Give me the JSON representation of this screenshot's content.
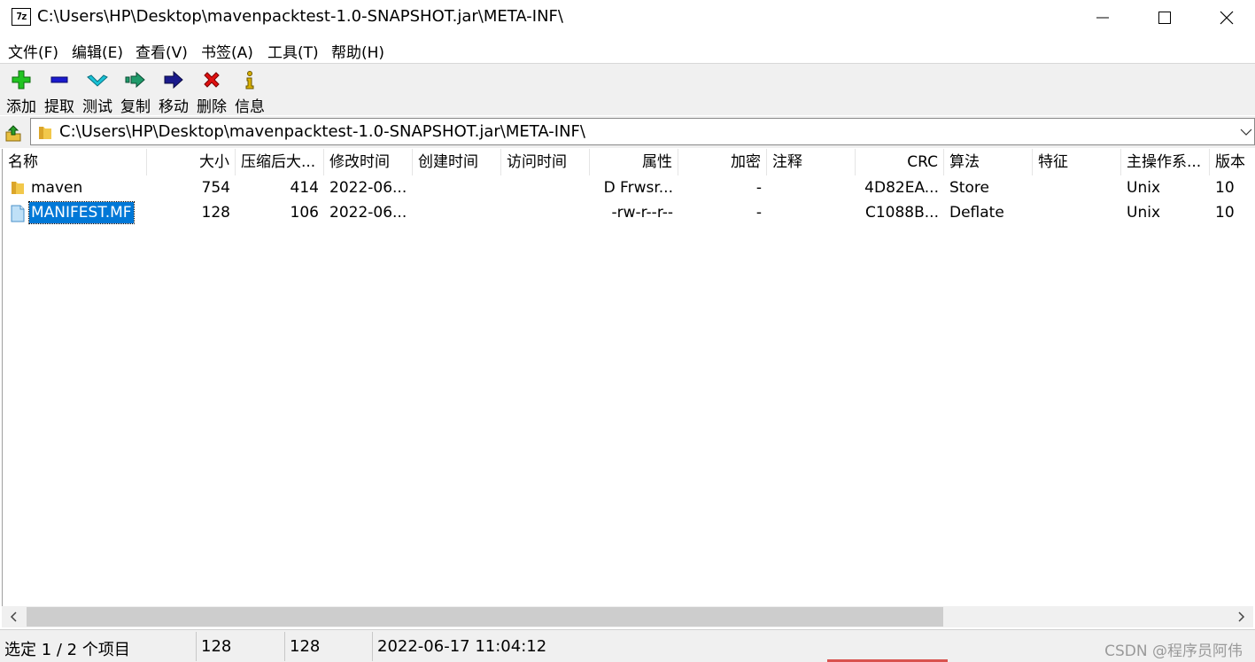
{
  "window": {
    "icon_text": "7z",
    "title": "C:\\Users\\HP\\Desktop\\mavenpacktest-1.0-SNAPSHOT.jar\\META-INF\\"
  },
  "menu": [
    {
      "label": "文件(F)"
    },
    {
      "label": "编辑(E)"
    },
    {
      "label": "查看(V)"
    },
    {
      "label": "书签(A)"
    },
    {
      "label": "工具(T)"
    },
    {
      "label": "帮助(H)"
    }
  ],
  "toolbar": [
    {
      "label": "添加",
      "icon": "plus-icon",
      "color": "#22b422"
    },
    {
      "label": "提取",
      "icon": "minus-icon",
      "color": "#1a1acd"
    },
    {
      "label": "测试",
      "icon": "check-icon",
      "color": "#19b6c8"
    },
    {
      "label": "复制",
      "icon": "double-arrow-icon",
      "color": "#1f9a6a"
    },
    {
      "label": "移动",
      "icon": "arrow-right-icon",
      "color": "#1a1a8c"
    },
    {
      "label": "删除",
      "icon": "x-icon",
      "color": "#e01010"
    },
    {
      "label": "信息",
      "icon": "info-icon",
      "color": "#c8a000"
    }
  ],
  "address": {
    "path": "C:\\Users\\HP\\Desktop\\mavenpacktest-1.0-SNAPSHOT.jar\\META-INF\\"
  },
  "columns": [
    {
      "label": "名称"
    },
    {
      "label": "大小"
    },
    {
      "label": "压缩后大..."
    },
    {
      "label": "修改时间"
    },
    {
      "label": "创建时间"
    },
    {
      "label": "访问时间"
    },
    {
      "label": "属性"
    },
    {
      "label": "加密"
    },
    {
      "label": "注释"
    },
    {
      "label": "CRC"
    },
    {
      "label": "算法"
    },
    {
      "label": "特征"
    },
    {
      "label": "主操作系..."
    },
    {
      "label": "版本"
    }
  ],
  "rows": [
    {
      "icon": "folder-icon",
      "name": "maven",
      "size": "754",
      "packed": "414",
      "modified": "2022-06...",
      "created": "",
      "accessed": "",
      "attributes": "D Frwsr...",
      "encrypted": "-",
      "comment": "",
      "crc": "4D82EA...",
      "method": "Store",
      "characteristics": "",
      "host_os": "Unix",
      "version": "10",
      "selected": false
    },
    {
      "icon": "file-icon",
      "name": "MANIFEST.MF",
      "size": "128",
      "packed": "106",
      "modified": "2022-06...",
      "created": "",
      "accessed": "",
      "attributes": "-rw-r--r--",
      "encrypted": "-",
      "comment": "",
      "crc": "C1088B...",
      "method": "Deflate",
      "characteristics": "",
      "host_os": "Unix",
      "version": "10",
      "selected": true
    }
  ],
  "status": {
    "selection": "选定 1 / 2 个项目",
    "size": "128",
    "packed": "128",
    "modified": "2022-06-17 11:04:12"
  },
  "watermark": "CSDN @程序员阿伟",
  "colors": {
    "selection": "#0078d7",
    "toolbar_bg": "#f0f0f0"
  }
}
